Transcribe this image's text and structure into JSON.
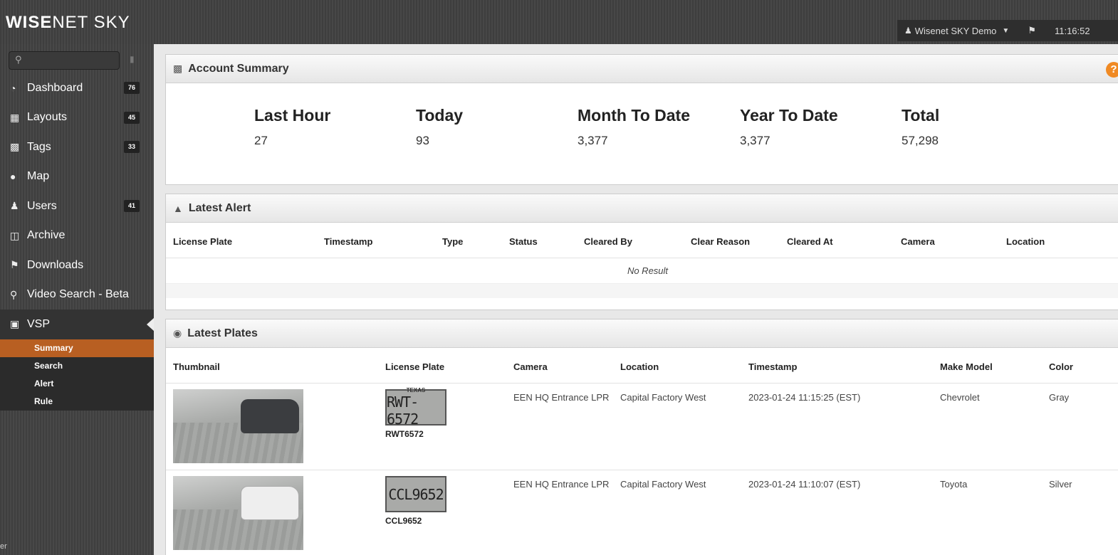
{
  "header": {
    "logo_bold": "WISE",
    "logo_rest": "NET SKY",
    "user_name": "Wisenet SKY Demo",
    "clock": "11:16:52"
  },
  "sidebar": {
    "items": [
      {
        "label": "Dashboard",
        "icon": "dashboard-icon",
        "badge": "76"
      },
      {
        "label": "Layouts",
        "icon": "layouts-icon",
        "badge": "45"
      },
      {
        "label": "Tags",
        "icon": "camera-icon",
        "badge": "33"
      },
      {
        "label": "Map",
        "icon": "globe-icon",
        "badge": ""
      },
      {
        "label": "Users",
        "icon": "users-icon",
        "badge": "41"
      },
      {
        "label": "Archive",
        "icon": "folder-icon",
        "badge": ""
      },
      {
        "label": "Downloads",
        "icon": "flag-icon",
        "badge": ""
      },
      {
        "label": "Video Search - Beta",
        "icon": "search-icon",
        "badge": ""
      },
      {
        "label": "VSP",
        "icon": "car-icon",
        "badge": ""
      }
    ],
    "sub_items": [
      "Summary",
      "Search",
      "Alert",
      "Rule"
    ],
    "active_sub": "Summary",
    "footer_text": "er"
  },
  "account_summary": {
    "title": "Account Summary",
    "stats": [
      {
        "label": "Last Hour",
        "value": "27"
      },
      {
        "label": "Today",
        "value": "93"
      },
      {
        "label": "Month To Date",
        "value": "3,377"
      },
      {
        "label": "Year To Date",
        "value": "3,377"
      },
      {
        "label": "Total",
        "value": "57,298"
      }
    ]
  },
  "latest_alert": {
    "title": "Latest Alert",
    "columns": [
      "License Plate",
      "Timestamp",
      "Type",
      "Status",
      "Cleared By",
      "Clear Reason",
      "Cleared At",
      "Camera",
      "Location"
    ],
    "empty_text": "No Result"
  },
  "latest_plates": {
    "title": "Latest Plates",
    "columns": [
      "Thumbnail",
      "License Plate",
      "Camera",
      "Location",
      "Timestamp",
      "Make Model",
      "Color"
    ],
    "rows": [
      {
        "plate": "RWT6572",
        "plate_image_text": "RWT-6572",
        "plate_state": "TEXAS",
        "camera": "EEN HQ Entrance LPR",
        "location": "Capital Factory West",
        "timestamp": "2023-01-24 11:15:25 (EST)",
        "make_model": "Chevrolet",
        "color": "Gray"
      },
      {
        "plate": "CCL9652",
        "plate_image_text": "CCL9652",
        "plate_state": "",
        "camera": "EEN HQ Entrance LPR",
        "location": "Capital Factory West",
        "timestamp": "2023-01-24 11:10:07 (EST)",
        "make_model": "Toyota",
        "color": "Silver"
      }
    ]
  }
}
